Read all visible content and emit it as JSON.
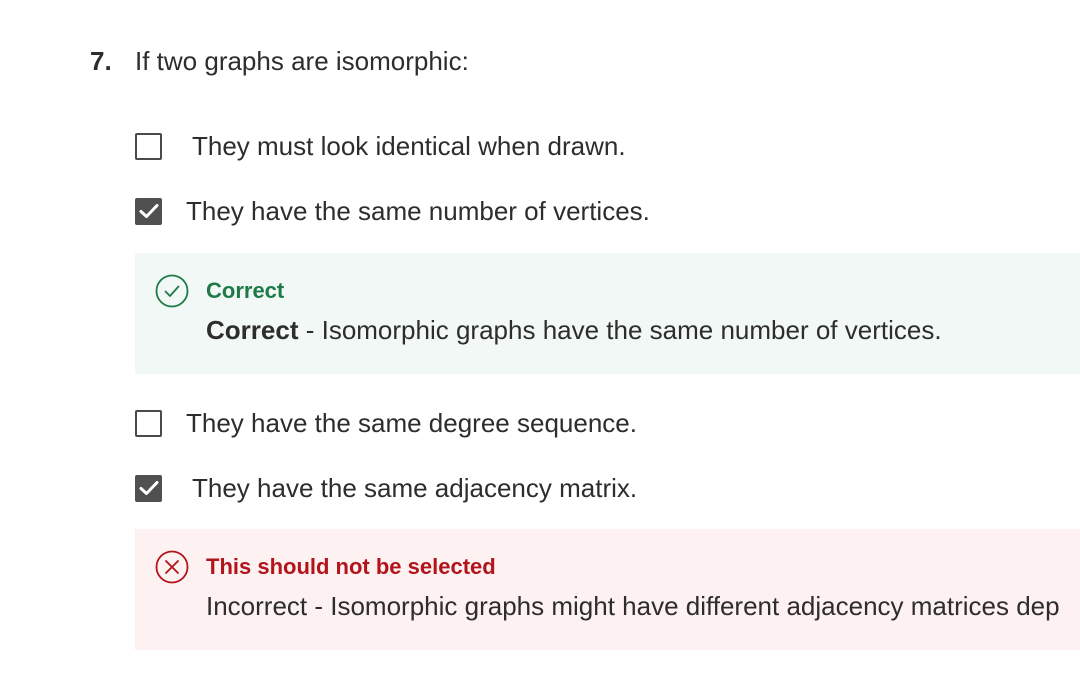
{
  "question": {
    "number": "7.",
    "text": "If two graphs are isomorphic:"
  },
  "options": [
    {
      "label": "They must look identical when drawn.",
      "checked": false
    },
    {
      "label": "They have the same number of vertices.",
      "checked": true
    },
    {
      "label": "They have the same degree sequence.",
      "checked": false
    },
    {
      "label": "They have the same adjacency matrix.",
      "checked": true
    }
  ],
  "feedback": {
    "option2": {
      "status": "correct",
      "icon": "check-circle-icon",
      "title": "Correct",
      "lead": "Correct",
      "text": " - Isomorphic graphs have the same number of vertices.",
      "color": "#1f7a48",
      "background": "#f2f8f5"
    },
    "option4": {
      "status": "incorrect",
      "icon": "x-circle-icon",
      "title": "This should not be selected",
      "text": "Incorrect - Isomorphic graphs might have different adjacency matrices dep",
      "color": "#b3141b",
      "background": "#fdf1f1"
    }
  }
}
